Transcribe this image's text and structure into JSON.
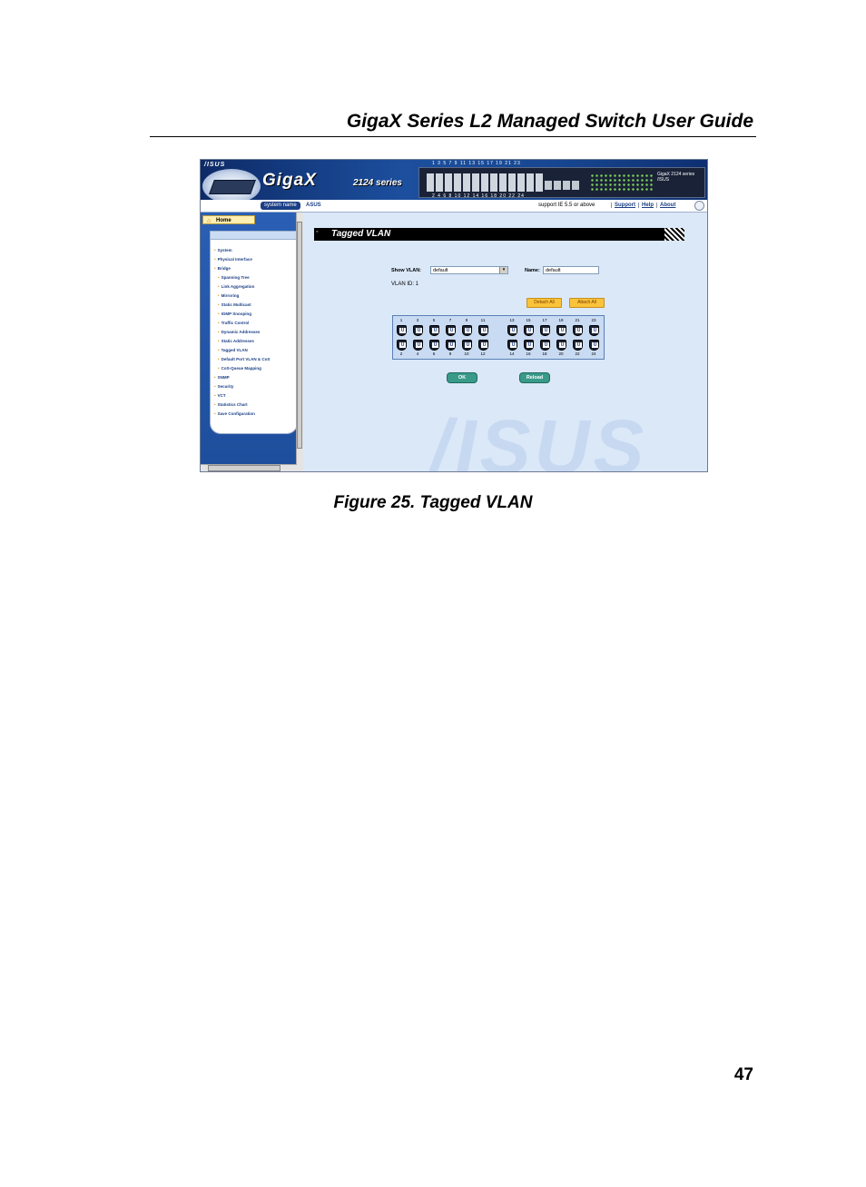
{
  "document": {
    "header_title": "GigaX Series L2 Managed Switch User Guide",
    "caption": "Figure 25.  Tagged VLAN",
    "page_number": "47"
  },
  "screenshot": {
    "banner": {
      "asus_tab": "/ISUS",
      "brand": "Giga",
      "brand_x": "X",
      "brand_series": "2124 series",
      "ports_top": "1  3  5  7  9  11  13  15  17  19  21  23",
      "ports_bottom": "2  4  6  8  10  12  14  16  18  20  22  24",
      "panel_label": "GigaX 2124 series  /ISUS"
    },
    "topbar": {
      "system_name_label": "system name",
      "system_name_value": "ASUS",
      "support_text": "support IE 5.5 or above",
      "links": [
        "Support",
        "Help",
        "About"
      ]
    },
    "sidebar": {
      "home_label": "Home",
      "menu": [
        {
          "label": "System",
          "sub": false
        },
        {
          "label": "Physical Interface",
          "sub": false
        },
        {
          "label": "Bridge",
          "sub": false
        },
        {
          "label": "Spanning Tree",
          "sub": true
        },
        {
          "label": "Link Aggregation",
          "sub": true
        },
        {
          "label": "Mirroring",
          "sub": true
        },
        {
          "label": "Static Multicast",
          "sub": true
        },
        {
          "label": "IGMP Snooping",
          "sub": true
        },
        {
          "label": "Traffic Control",
          "sub": true
        },
        {
          "label": "Dynamic Addresses",
          "sub": true
        },
        {
          "label": "Static Addresses",
          "sub": true
        },
        {
          "label": "Tagged VLAN",
          "sub": true
        },
        {
          "label": "Default Port VLAN & CoS",
          "sub": true
        },
        {
          "label": "CoS-Queue Mapping",
          "sub": true
        },
        {
          "label": "SNMP",
          "sub": false
        },
        {
          "label": "Security",
          "sub": false
        },
        {
          "label": "VCT",
          "sub": false
        },
        {
          "label": "Statistics Chart",
          "sub": false
        },
        {
          "label": "Save Configuration",
          "sub": false
        }
      ]
    },
    "content": {
      "watermark": "/ISUS",
      "page_title": "Tagged VLAN",
      "show_vlan_label": "Show VLAN:",
      "show_vlan_value": "default",
      "name_label": "Name:",
      "name_value": "default",
      "vlan_id_text": "VLAN ID:  1",
      "detach_all": "Detach All",
      "attach_all": "Attach All",
      "ports_odd": [
        "1",
        "3",
        "5",
        "7",
        "9",
        "11",
        "13",
        "15",
        "17",
        "19",
        "21",
        "23"
      ],
      "ports_even": [
        "2",
        "4",
        "6",
        "8",
        "10",
        "12",
        "14",
        "16",
        "18",
        "20",
        "22",
        "24"
      ],
      "port_state": "U",
      "ok": "OK",
      "reload": "Reload"
    }
  }
}
